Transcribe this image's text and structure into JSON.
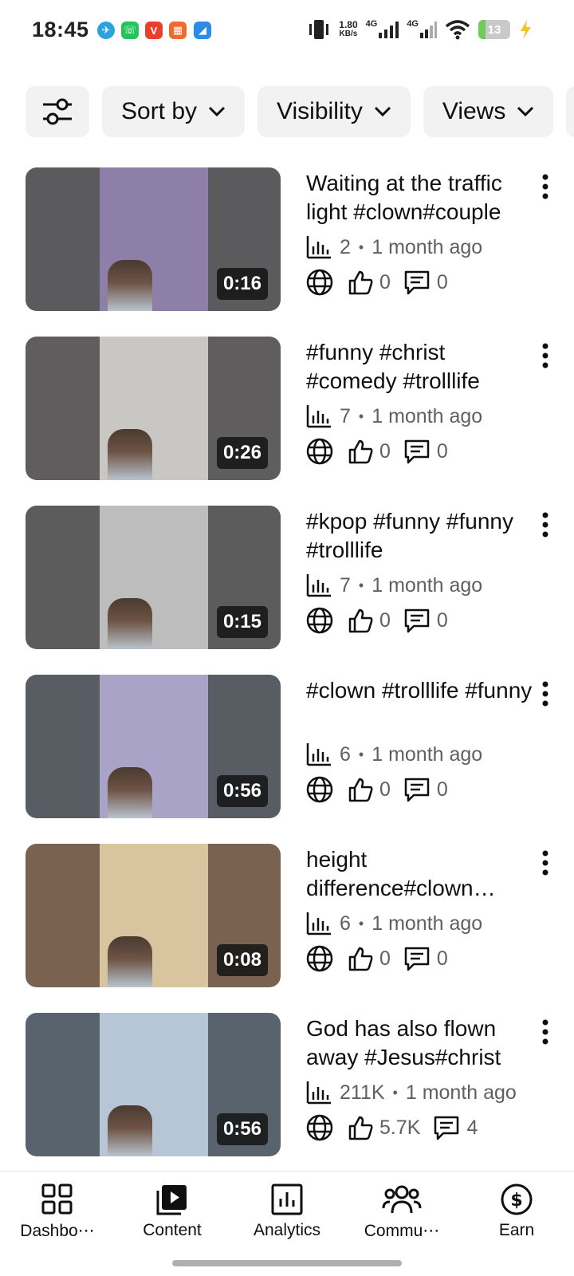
{
  "status_bar": {
    "time": "18:45",
    "speed_value": "1.80",
    "speed_unit": "KB/s",
    "net1": "4G",
    "net2": "4G",
    "battery": "13",
    "notification_apps": [
      "telegram-icon",
      "whatsapp-icon",
      "vivaldi-icon",
      "app-icon",
      "browser-icon"
    ]
  },
  "filters": {
    "sort_label": "Sort by",
    "visibility_label": "Visibility",
    "views_label": "Views"
  },
  "videos": [
    {
      "title": "Waiting at the traffic light #clown#couple",
      "views": "2",
      "age": "1 month ago",
      "likes": "0",
      "comments": "0",
      "duration": "0:16",
      "bg": "#5b5b5d",
      "center": "#8d7fa8"
    },
    {
      "title": "#funny #christ #comedy #trolllife",
      "views": "7",
      "age": "1 month ago",
      "likes": "0",
      "comments": "0",
      "duration": "0:26",
      "bg": "#5f5d5d",
      "center": "#c9c7c4"
    },
    {
      "title": "#kpop #funny #funny #trolllife",
      "views": "7",
      "age": "1 month ago",
      "likes": "0",
      "comments": "0",
      "duration": "0:15",
      "bg": "#5c5c5c",
      "center": "#bdbdbd"
    },
    {
      "title": "#clown #trolllife #funny",
      "views": "6",
      "age": "1 month ago",
      "likes": "0",
      "comments": "0",
      "duration": "0:56",
      "bg": "#585d63",
      "center": "#a8a3c7"
    },
    {
      "title": "height difference#clown #funny",
      "views": "6",
      "age": "1 month ago",
      "likes": "0",
      "comments": "0",
      "duration": "0:08",
      "bg": "#7a6250",
      "center": "#d9c4a0"
    },
    {
      "title": "God has also flown away #Jesus#christ",
      "views": "211K",
      "age": "1 month ago",
      "likes": "5.7K",
      "comments": "4",
      "duration": "0:56",
      "bg": "#59636d",
      "center": "#b7c6d6"
    }
  ],
  "nav": {
    "dashboard": "Dashbo⋯",
    "content": "Content",
    "analytics": "Analytics",
    "community": "Commu⋯",
    "earn": "Earn"
  }
}
